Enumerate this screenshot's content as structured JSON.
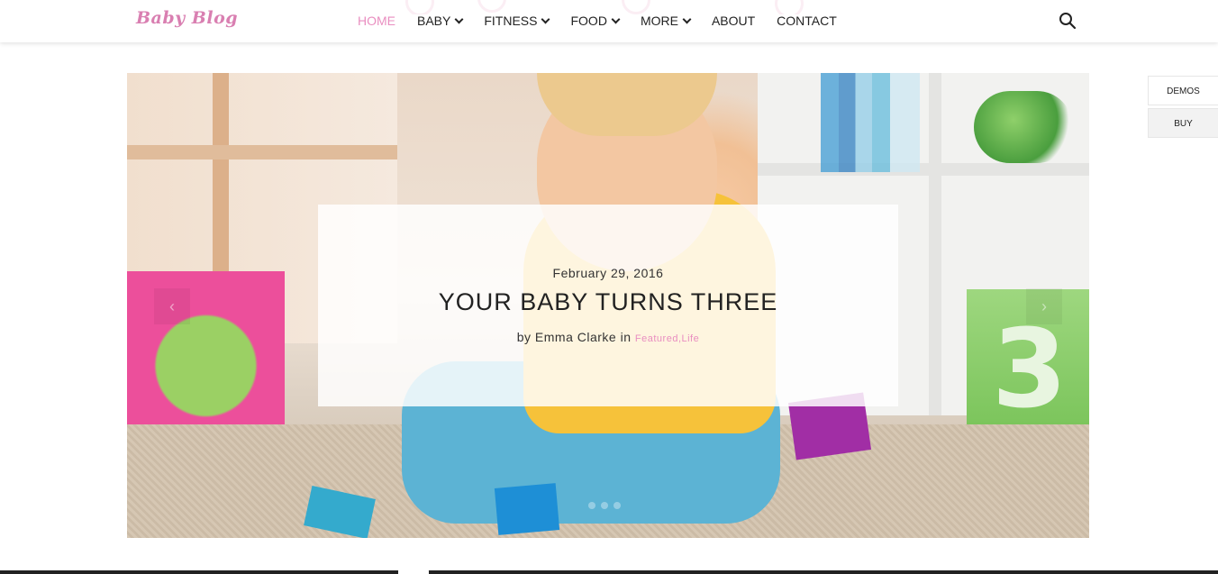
{
  "header": {
    "logo": "Baby Blog",
    "nav": [
      {
        "label": "HOME",
        "active": true,
        "dropdown": false
      },
      {
        "label": "BABY",
        "active": false,
        "dropdown": true
      },
      {
        "label": "FITNESS",
        "active": false,
        "dropdown": true
      },
      {
        "label": "FOOD",
        "active": false,
        "dropdown": true
      },
      {
        "label": "MORE",
        "active": false,
        "dropdown": true
      },
      {
        "label": "ABOUT",
        "active": false,
        "dropdown": false
      },
      {
        "label": "CONTACT",
        "active": false,
        "dropdown": false
      }
    ],
    "search_icon": "search-icon"
  },
  "side_buttons": {
    "demos": "DEMOS",
    "buy": "BUY"
  },
  "slider": {
    "prev_icon": "chevron-left-icon",
    "next_icon": "chevron-right-icon",
    "prev_glyph": "‹",
    "next_glyph": "›",
    "dots_count": 3,
    "slide": {
      "date": "February 29, 2016",
      "title": "YOUR BABY TURNS THREE",
      "by_prefix": "by",
      "author": "Emma Clarke",
      "in_text": "in",
      "category_1": "Featured",
      "separator": ",",
      "category_2": "Life"
    }
  },
  "colors": {
    "accent": "#e98ec0",
    "text": "#222222",
    "logo": "#d97fb1"
  }
}
